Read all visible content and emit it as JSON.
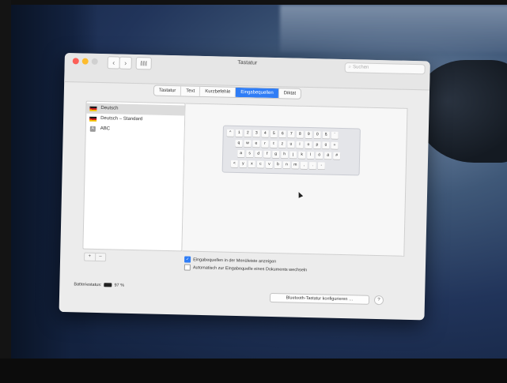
{
  "window": {
    "title": "Tastatur",
    "search_placeholder": "Suchen",
    "nav_back": "‹",
    "nav_forward": "›"
  },
  "tabs": [
    {
      "label": "Tastatur",
      "active": false
    },
    {
      "label": "Text",
      "active": false
    },
    {
      "label": "Kurzbefehle",
      "active": false
    },
    {
      "label": "Eingabequellen",
      "active": true
    },
    {
      "label": "Diktat",
      "active": false
    }
  ],
  "sources": [
    {
      "label": "Deutsch",
      "icon": "german-flag-icon",
      "selected": true
    },
    {
      "label": "Deutsch – Standard",
      "icon": "german-flag-icon",
      "selected": false
    },
    {
      "label": "ABC",
      "icon": "abc-icon",
      "icon_text": "A",
      "selected": false
    }
  ],
  "keyboard": {
    "rows": [
      [
        "^",
        "1",
        "2",
        "3",
        "4",
        "5",
        "6",
        "7",
        "8",
        "9",
        "0",
        "ß",
        "´"
      ],
      [
        "q",
        "w",
        "e",
        "r",
        "t",
        "z",
        "u",
        "i",
        "o",
        "p",
        "ü",
        "+"
      ],
      [
        "a",
        "s",
        "d",
        "f",
        "g",
        "h",
        "j",
        "k",
        "l",
        "ö",
        "ä",
        "#"
      ],
      [
        "<",
        "y",
        "x",
        "c",
        "v",
        "b",
        "n",
        "m",
        ",",
        ".",
        "-"
      ]
    ]
  },
  "list_controls": {
    "add": "+",
    "remove": "–"
  },
  "options": [
    {
      "label": "Eingabequellen in der Menüleiste anzeigen",
      "checked": true
    },
    {
      "label": "Automatisch zur Eingabequelle eines Dokuments wechseln",
      "checked": false
    }
  ],
  "footer": {
    "battery_label": "Batteriestatus:",
    "battery_value": "97 %",
    "bluetooth_button": "Bluetooth-Tastatur konfigurieren …",
    "help": "?"
  },
  "colors": {
    "accent": "#2f7df6"
  }
}
